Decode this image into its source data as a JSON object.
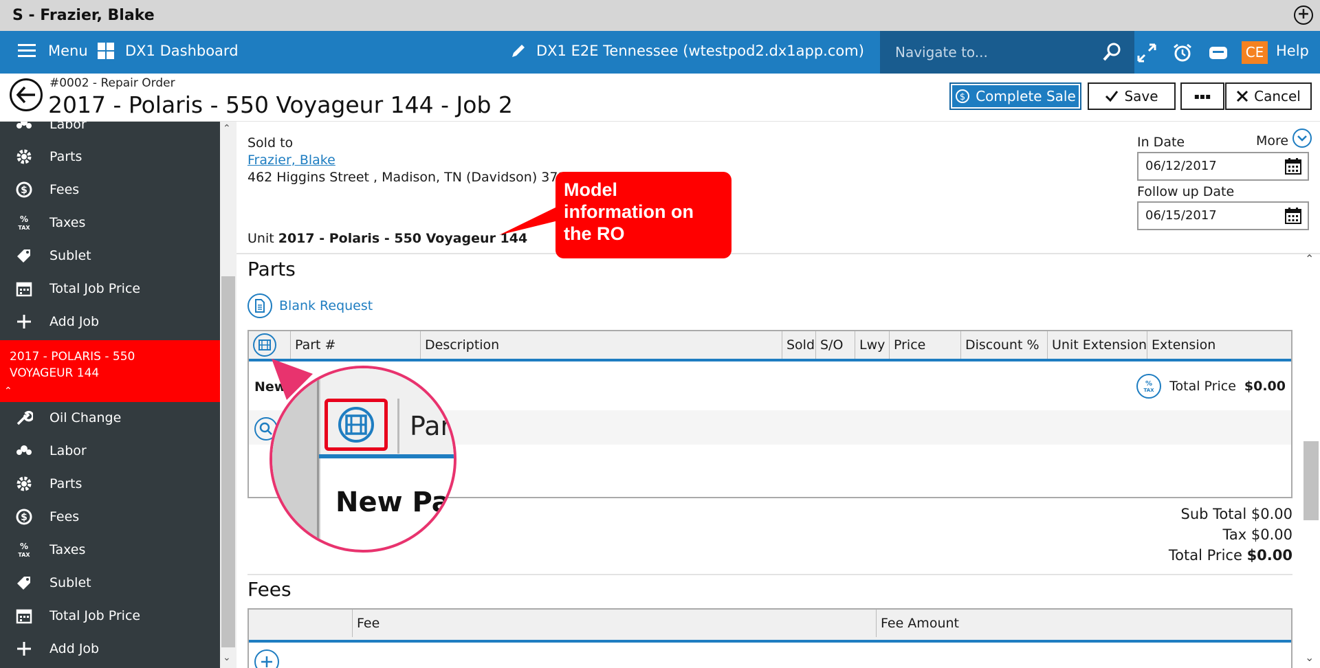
{
  "window": {
    "title": "S - Frazier, Blake"
  },
  "nav": {
    "menu_label": "Menu",
    "dashboard_label": "DX1 Dashboard",
    "environment": "DX1 E2E Tennessee (wtestpod2.dx1app.com)",
    "search_placeholder": "Navigate to...",
    "user_initials": "CE",
    "help_label": "Help"
  },
  "header": {
    "subtitle": "#0002 - Repair Order",
    "title": "2017 - Polaris - 550 Voyageur 144 - Job 2",
    "complete_sale_label": "Complete Sale",
    "save_label": "Save",
    "more_label": "▪▪▪",
    "cancel_label": "Cancel"
  },
  "sidebar": {
    "top_items": [
      {
        "label": "Labor",
        "icon": "labor-icon"
      },
      {
        "label": "Parts",
        "icon": "gear-icon"
      },
      {
        "label": "Fees",
        "icon": "dollar-icon"
      },
      {
        "label": "Taxes",
        "icon": "tax-icon"
      },
      {
        "label": "Sublet",
        "icon": "tag-icon"
      },
      {
        "label": "Total Job Price",
        "icon": "calendar-icon"
      },
      {
        "label": "Add Job",
        "icon": "plus-icon"
      }
    ],
    "job_label": "2017 - POLARIS - 550 VOYAGEUR 144",
    "job_items": [
      {
        "label": "Oil Change",
        "icon": "wrench-icon"
      },
      {
        "label": "Labor",
        "icon": "labor-icon"
      },
      {
        "label": "Parts",
        "icon": "gear-icon"
      },
      {
        "label": "Fees",
        "icon": "dollar-icon"
      },
      {
        "label": "Taxes",
        "icon": "tax-icon"
      },
      {
        "label": "Sublet",
        "icon": "tag-icon"
      },
      {
        "label": "Total Job Price",
        "icon": "calendar-icon"
      },
      {
        "label": "Add Job",
        "icon": "plus-icon"
      }
    ],
    "active_color": "#ff0000"
  },
  "customer": {
    "sold_to_label": "Sold to",
    "name": "Frazier, Blake",
    "address": "462 Higgins Street , Madison, TN (Davidson) 37115",
    "unit_prefix": "Unit",
    "unit": "2017 - Polaris - 550 Voyageur 144"
  },
  "dates": {
    "in_date_label": "In Date",
    "in_date": "06/12/2017",
    "more_label": "More",
    "follow_up_label": "Follow up Date",
    "follow_up": "06/15/2017"
  },
  "parts": {
    "title": "Parts",
    "blank_request_label": "Blank Request",
    "columns": [
      "Part #",
      "Description",
      "Sold",
      "S/O",
      "Lwy",
      "Price",
      "Discount %",
      "Unit Extension",
      "Extension"
    ],
    "new_row_label": "New",
    "total_price_label": "Total Price",
    "total_price": "$0.00",
    "sub_total": "Sub Total $0.00",
    "tax": "Tax $0.00",
    "total_label": "Total Price",
    "total": "$0.00"
  },
  "fees": {
    "title": "Fees",
    "columns": [
      "Fee",
      "Fee Amount"
    ]
  },
  "callout": {
    "text": "Model information on the RO",
    "color": "#ff0000"
  },
  "magnifier": {
    "header_text": "Par",
    "row_text": "New Par",
    "ring_color": "#e8336e",
    "highlight_color": "#e8001c"
  }
}
